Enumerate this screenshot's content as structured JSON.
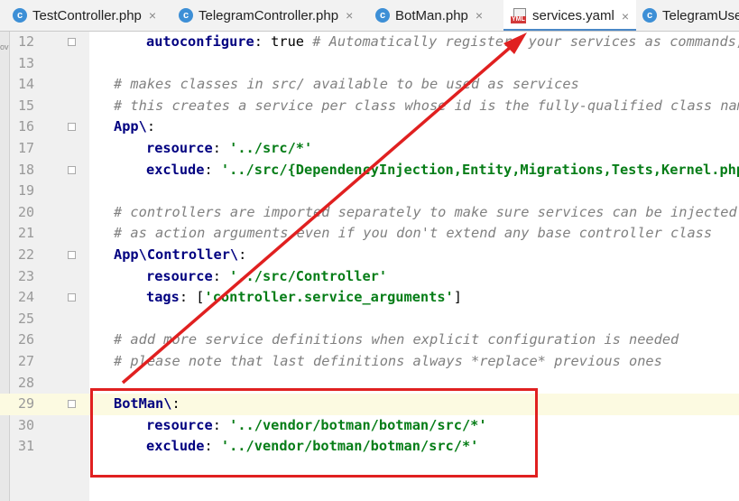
{
  "tabs": [
    {
      "label": "TestController.php",
      "icon": "c",
      "close": "×"
    },
    {
      "label": "TelegramController.php",
      "icon": "c",
      "close": "×"
    },
    {
      "label": "BotMan.php",
      "icon": "c",
      "close": "×"
    },
    {
      "label": "services.yaml",
      "icon": "yml",
      "icon_text": "YML",
      "close": "×"
    },
    {
      "label": "TelegramUse",
      "icon": "c"
    }
  ],
  "left_strip_text": "ov",
  "lines": [
    {
      "num": "12",
      "key": "autoconfigure",
      "sep": ": ",
      "value": "true",
      "comment": " # Automatically registers your services as commands,"
    },
    {
      "num": "13"
    },
    {
      "num": "14",
      "comment": "# makes classes in src/ available to be used as services"
    },
    {
      "num": "15",
      "comment": "# this creates a service per class whose id is the fully-qualified class name"
    },
    {
      "num": "16",
      "key": "App\\",
      "sep": ":"
    },
    {
      "num": "17",
      "key": "resource",
      "sep": ": ",
      "str": "'../src/*'"
    },
    {
      "num": "18",
      "key": "exclude",
      "sep": ": ",
      "str": "'../src/{DependencyInjection,Entity,Migrations,Tests,Kernel.php}'"
    },
    {
      "num": "19"
    },
    {
      "num": "20",
      "comment": "# controllers are imported separately to make sure services can be injected"
    },
    {
      "num": "21",
      "comment": "# as action arguments even if you don't extend any base controller class"
    },
    {
      "num": "22",
      "key": "App\\Controller\\",
      "sep": ":"
    },
    {
      "num": "23",
      "key": "resource",
      "sep": ": ",
      "str": "'../src/Controller'"
    },
    {
      "num": "24",
      "key": "tags",
      "sep": ": [",
      "str": "'controller.service_arguments'",
      "end": "]"
    },
    {
      "num": "25"
    },
    {
      "num": "26",
      "comment": "# add more service definitions when explicit configuration is needed"
    },
    {
      "num": "27",
      "comment": "# please note that last definitions always *replace* previous ones"
    },
    {
      "num": "28"
    },
    {
      "num": "29",
      "key": "BotMan\\",
      "sep": ":"
    },
    {
      "num": "30",
      "key": "resource",
      "sep": ": ",
      "str": "'../vendor/botman/botman/src/*'"
    },
    {
      "num": "31",
      "key": "exclude",
      "sep": ": ",
      "str": "'../vendor/botman/botman/src/*'"
    }
  ],
  "highlighted_line": "29",
  "colors": {
    "keyword": "#000080",
    "string": "#067d17",
    "comment": "#808080",
    "annotation": "#e02020",
    "tab_accent": "#4a88c7"
  }
}
